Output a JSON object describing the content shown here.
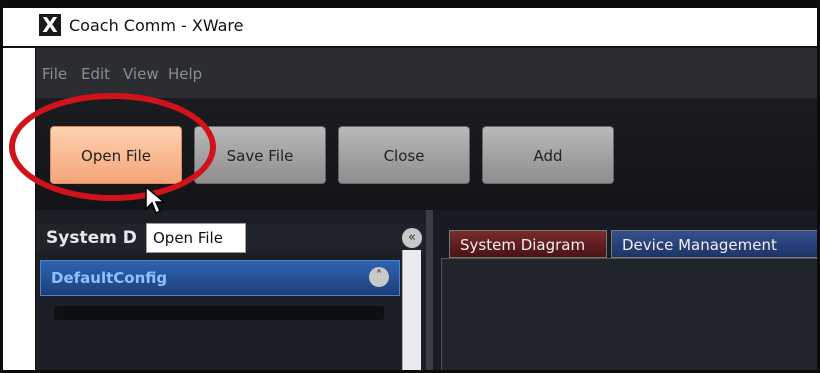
{
  "window": {
    "title": "Coach Comm - XWare",
    "logo": "X"
  },
  "menu": [
    "File",
    "Edit",
    "View",
    "Help"
  ],
  "toolbar": {
    "buttons": [
      {
        "label": "Open File",
        "active": true
      },
      {
        "label": "Save File",
        "active": false
      },
      {
        "label": "Close",
        "active": false
      },
      {
        "label": "Add",
        "active": false
      }
    ]
  },
  "tooltip": "Open File",
  "left_panel": {
    "title": "System D",
    "config_name": "DefaultConfig"
  },
  "tabs": [
    "System Diagram",
    "Device Management"
  ],
  "colors": {
    "highlight_ring": "#d0121a",
    "active_button": "#f4a579",
    "config_bar": "#2f63b0"
  }
}
